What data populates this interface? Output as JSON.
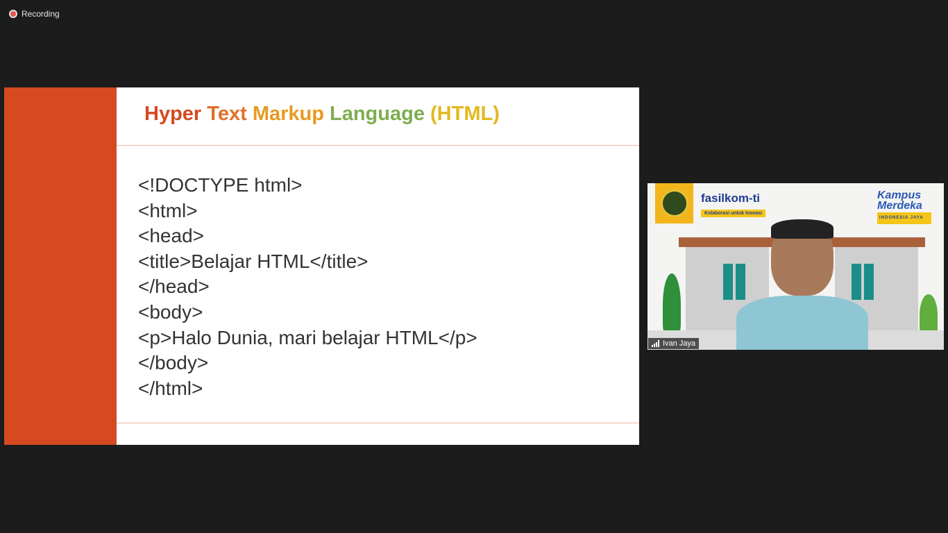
{
  "recording": {
    "label": "Recording"
  },
  "slide": {
    "title_words": [
      {
        "text": "Hyper ",
        "color": "#d54a21"
      },
      {
        "text": "Text ",
        "color": "#e0702a"
      },
      {
        "text": "Markup ",
        "color": "#e79a22"
      },
      {
        "text": "Language ",
        "color": "#7fae4f"
      },
      {
        "text": "(HTML)",
        "color": "#e2b91e"
      }
    ],
    "code_lines": [
      "<!DOCTYPE html>",
      "<html>",
      "<head>",
      "<title>Belajar HTML</title>",
      "</head>",
      "<body>",
      "<p>Halo Dunia, mari belajar HTML</p>",
      "</body>",
      "</html>"
    ],
    "accent_color": "#d54a21"
  },
  "video": {
    "participant_name": "Ivan Jaya",
    "fasilkom_name": "fasilkom-ti",
    "fasilkom_tagline": "Kolaborasi untuk Inovasi",
    "kampus_line1": "Kampus",
    "kampus_line2": "Merdeka",
    "kampus_sub": "INDONESIA JAYA"
  }
}
